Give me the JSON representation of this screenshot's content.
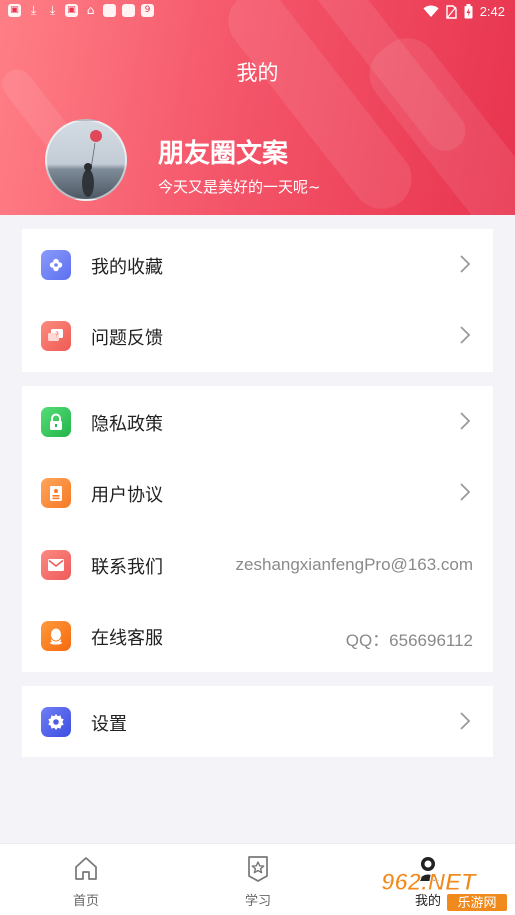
{
  "status_bar": {
    "time": "2:42"
  },
  "header": {
    "title": "我的",
    "profile_name": "朋友圈文案",
    "profile_subtitle": "今天又是美好的一天呢~"
  },
  "menu_groups": [
    {
      "items": [
        {
          "label": "我的收藏",
          "icon": "favorites-icon",
          "color": "#6f84f5"
        },
        {
          "label": "问题反馈",
          "icon": "feedback-icon",
          "color": "#f36860"
        }
      ]
    },
    {
      "items": [
        {
          "label": "隐私政策",
          "icon": "lock-icon",
          "color": "#34c759"
        },
        {
          "label": "用户协议",
          "icon": "document-icon",
          "color": "#fb8b3d"
        },
        {
          "label": "联系我们",
          "icon": "mail-icon",
          "color": "#f36860",
          "value": "zeshangxianfengPro@163.com"
        },
        {
          "label": "在线客服",
          "icon": "qq-icon",
          "color": "#fb7d24",
          "value": "QQ：656696112"
        }
      ]
    },
    {
      "items": [
        {
          "label": "设置",
          "icon": "gear-icon",
          "color": "#4e5de8"
        }
      ]
    }
  ],
  "tabbar": {
    "tabs": [
      {
        "label": "首页",
        "icon": "home-icon"
      },
      {
        "label": "学习",
        "icon": "study-icon"
      },
      {
        "label": "我的",
        "icon": "user-icon"
      }
    ]
  },
  "watermark": {
    "text1": "962.NET",
    "text2": "乐游网"
  },
  "colors": {
    "header_gradient_start": "#ff7f86",
    "header_gradient_end": "#e8344f",
    "background": "#f4f4f8"
  }
}
